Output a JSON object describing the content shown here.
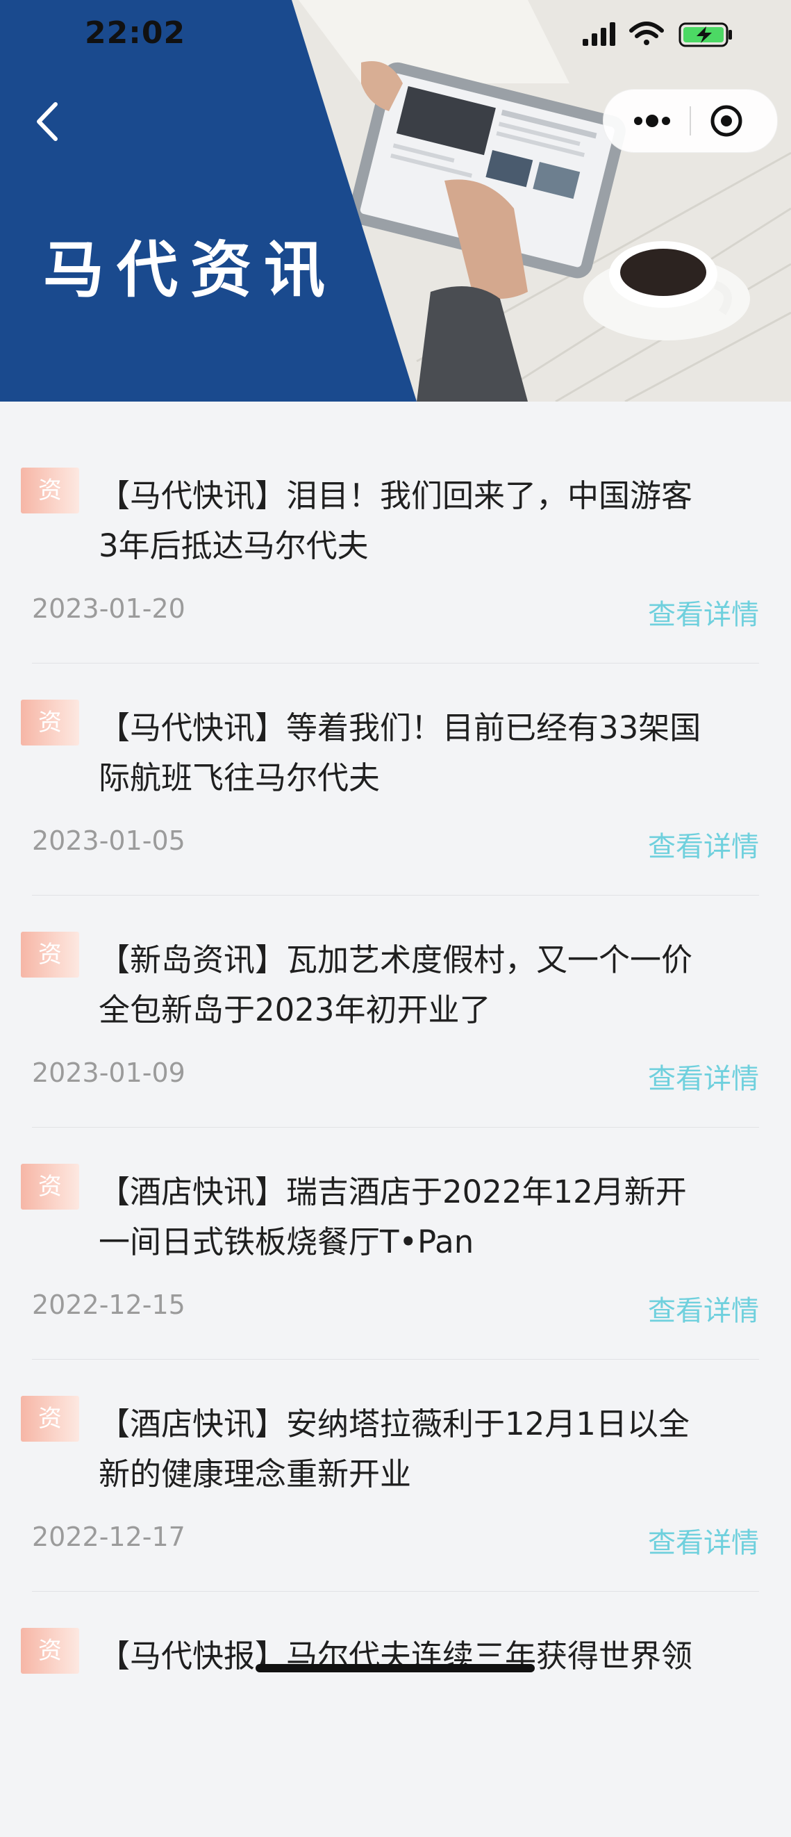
{
  "status": {
    "time": "22:02"
  },
  "header": {
    "title": "马代资讯"
  },
  "items": [
    {
      "tag": "资",
      "title_line1": "【马代快讯】泪目！我们回来了，中国游客",
      "title_line2": "3年后抵达马尔代夫",
      "date": "2023-01-20",
      "action": "查看详情"
    },
    {
      "tag": "资",
      "title_line1": "【马代快讯】等着我们！目前已经有33架国",
      "title_line2": "际航班飞往马尔代夫",
      "date": "2023-01-05",
      "action": "查看详情"
    },
    {
      "tag": "资",
      "title_line1": "【新岛资讯】瓦加艺术度假村，又一个一价",
      "title_line2": "全包新岛于2023年初开业了",
      "date": "2023-01-09",
      "action": "查看详情"
    },
    {
      "tag": "资",
      "title_line1": "【酒店快讯】瑞吉酒店于2022年12月新开",
      "title_line2": "一间日式铁板烧餐厅T•Pan",
      "date": "2022-12-15",
      "action": "查看详情"
    },
    {
      "tag": "资",
      "title_line1": "【酒店快讯】安纳塔拉薇利于12月1日以全",
      "title_line2": "新的健康理念重新开业",
      "date": "2022-12-17",
      "action": "查看详情"
    },
    {
      "tag": "资",
      "title_line1": "【马代快报】马尔代夫连续三年获得世界领",
      "title_line2": "",
      "date": "",
      "action": ""
    }
  ],
  "colors": {
    "banner_blue": "#1a4a8e",
    "link": "#6fd0dd",
    "tag": "#f6b6a6"
  },
  "icons": [
    "back-chevron-icon",
    "more-dots-icon",
    "target-icon",
    "signal-icon",
    "wifi-icon",
    "battery-charging-icon"
  ]
}
